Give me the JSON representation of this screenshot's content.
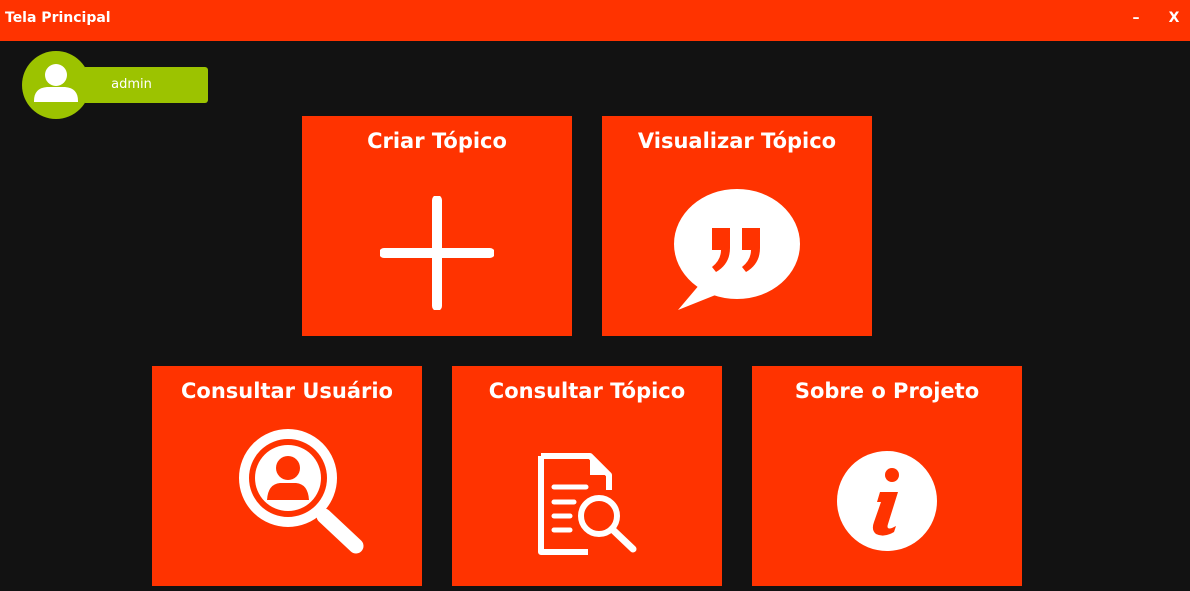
{
  "window": {
    "title": "Tela Principal",
    "minimize_label": "–",
    "close_label": "X"
  },
  "user": {
    "name": "admin"
  },
  "tiles": [
    {
      "id": "criar",
      "label": "Criar Tópico",
      "icon": "plus-icon"
    },
    {
      "id": "visualizar",
      "label": "Visualizar Tópico",
      "icon": "speech-bubble-quote-icon"
    },
    {
      "id": "usuario",
      "label": "Consultar Usuário",
      "icon": "search-user-icon"
    },
    {
      "id": "consultar",
      "label": "Consultar Tópico",
      "icon": "document-search-icon"
    },
    {
      "id": "sobre",
      "label": "Sobre o Projeto",
      "icon": "info-icon"
    }
  ],
  "colors": {
    "accent": "#ff3300",
    "user_badge": "#9cc300",
    "background": "#121212",
    "foreground": "#ffffff"
  }
}
